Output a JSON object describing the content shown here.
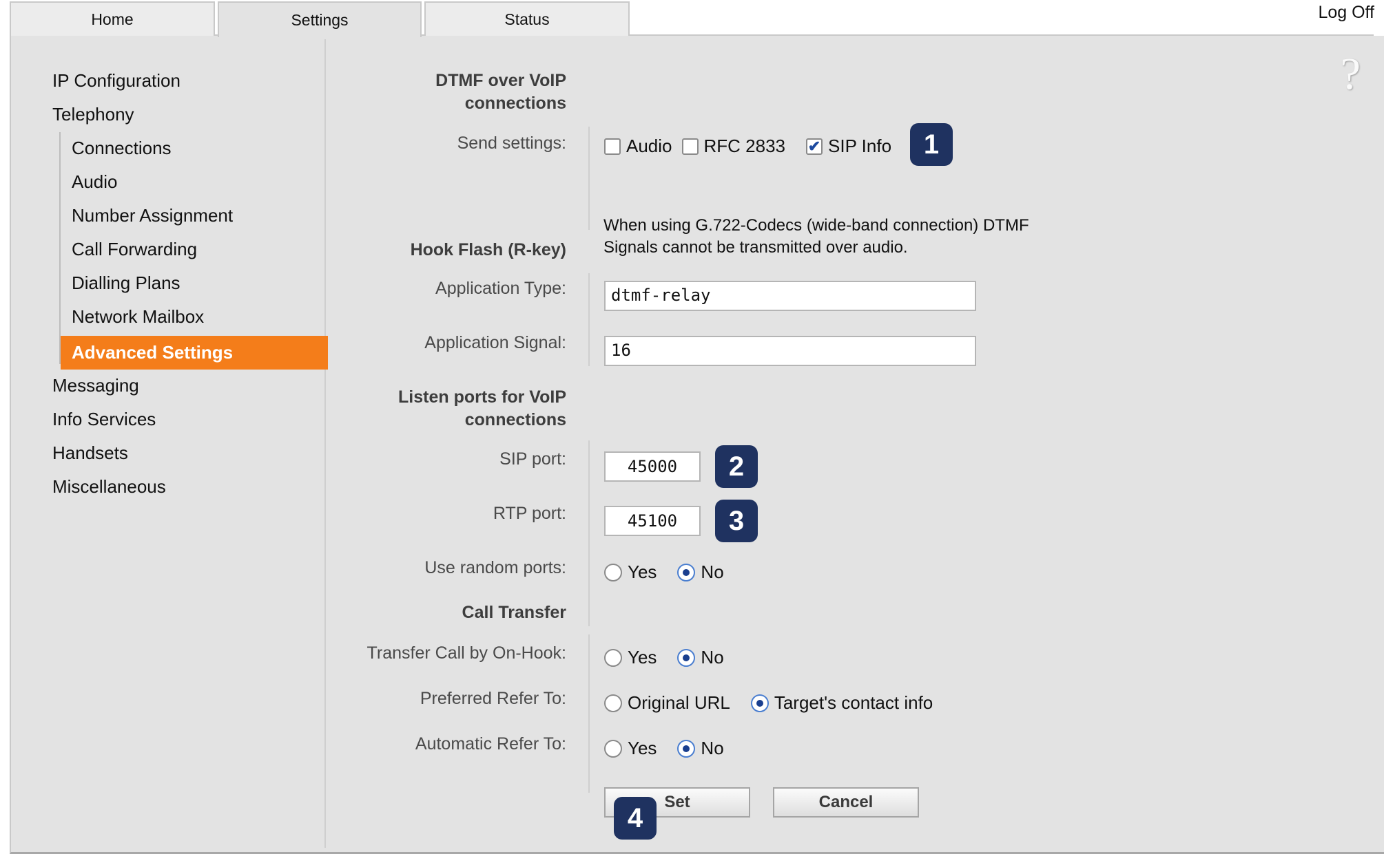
{
  "tabs": {
    "home": "Home",
    "settings": "Settings",
    "status": "Status"
  },
  "header": {
    "logoff": "Log Off",
    "help": "?"
  },
  "sidebar": {
    "items": [
      "IP Configuration",
      "Telephony",
      "Messaging",
      "Info Services",
      "Handsets",
      "Miscellaneous"
    ],
    "telephony_sub": [
      "Connections",
      "Audio",
      "Number Assignment",
      "Call Forwarding",
      "Dialling Plans",
      "Network Mailbox"
    ],
    "active": "Advanced Settings"
  },
  "form": {
    "dtmf_heading_1": "DTMF over VoIP",
    "dtmf_heading_2": "connections",
    "send_settings_label": "Send settings:",
    "send_options": {
      "audio": "Audio",
      "rfc": "RFC 2833",
      "sip_info": "SIP Info"
    },
    "send_checked": {
      "audio": false,
      "rfc": false,
      "sip_info": true
    },
    "note_1": "When using G.722-Codecs (wide-band connection) DTMF",
    "note_2": "Signals cannot be transmitted over audio.",
    "hook_heading": "Hook Flash (R-key)",
    "app_type_label": "Application Type:",
    "app_type_value": "dtmf-relay",
    "app_signal_label": "Application Signal:",
    "app_signal_value": "16",
    "listen_heading_1": "Listen ports for VoIP",
    "listen_heading_2": "connections",
    "sip_port_label": "SIP port:",
    "sip_port_value": "45000",
    "rtp_port_label": "RTP port:",
    "rtp_port_value": "45100",
    "random_label": "Use random ports:",
    "call_transfer_heading": "Call Transfer",
    "transfer_onhook_label": "Transfer Call by On-Hook:",
    "preferred_refer_label": "Preferred Refer To:",
    "preferred_original": "Original URL",
    "preferred_target": "Target's contact info",
    "automatic_refer_label": "Automatic Refer To:",
    "yes": "Yes",
    "no": "No",
    "set_label": "Set",
    "cancel_label": "Cancel"
  },
  "badges": [
    "1",
    "2",
    "3",
    "4"
  ],
  "colors": {
    "accent": "#f47d1a",
    "badge": "#1f3260",
    "panel": "#e3e3e3"
  }
}
